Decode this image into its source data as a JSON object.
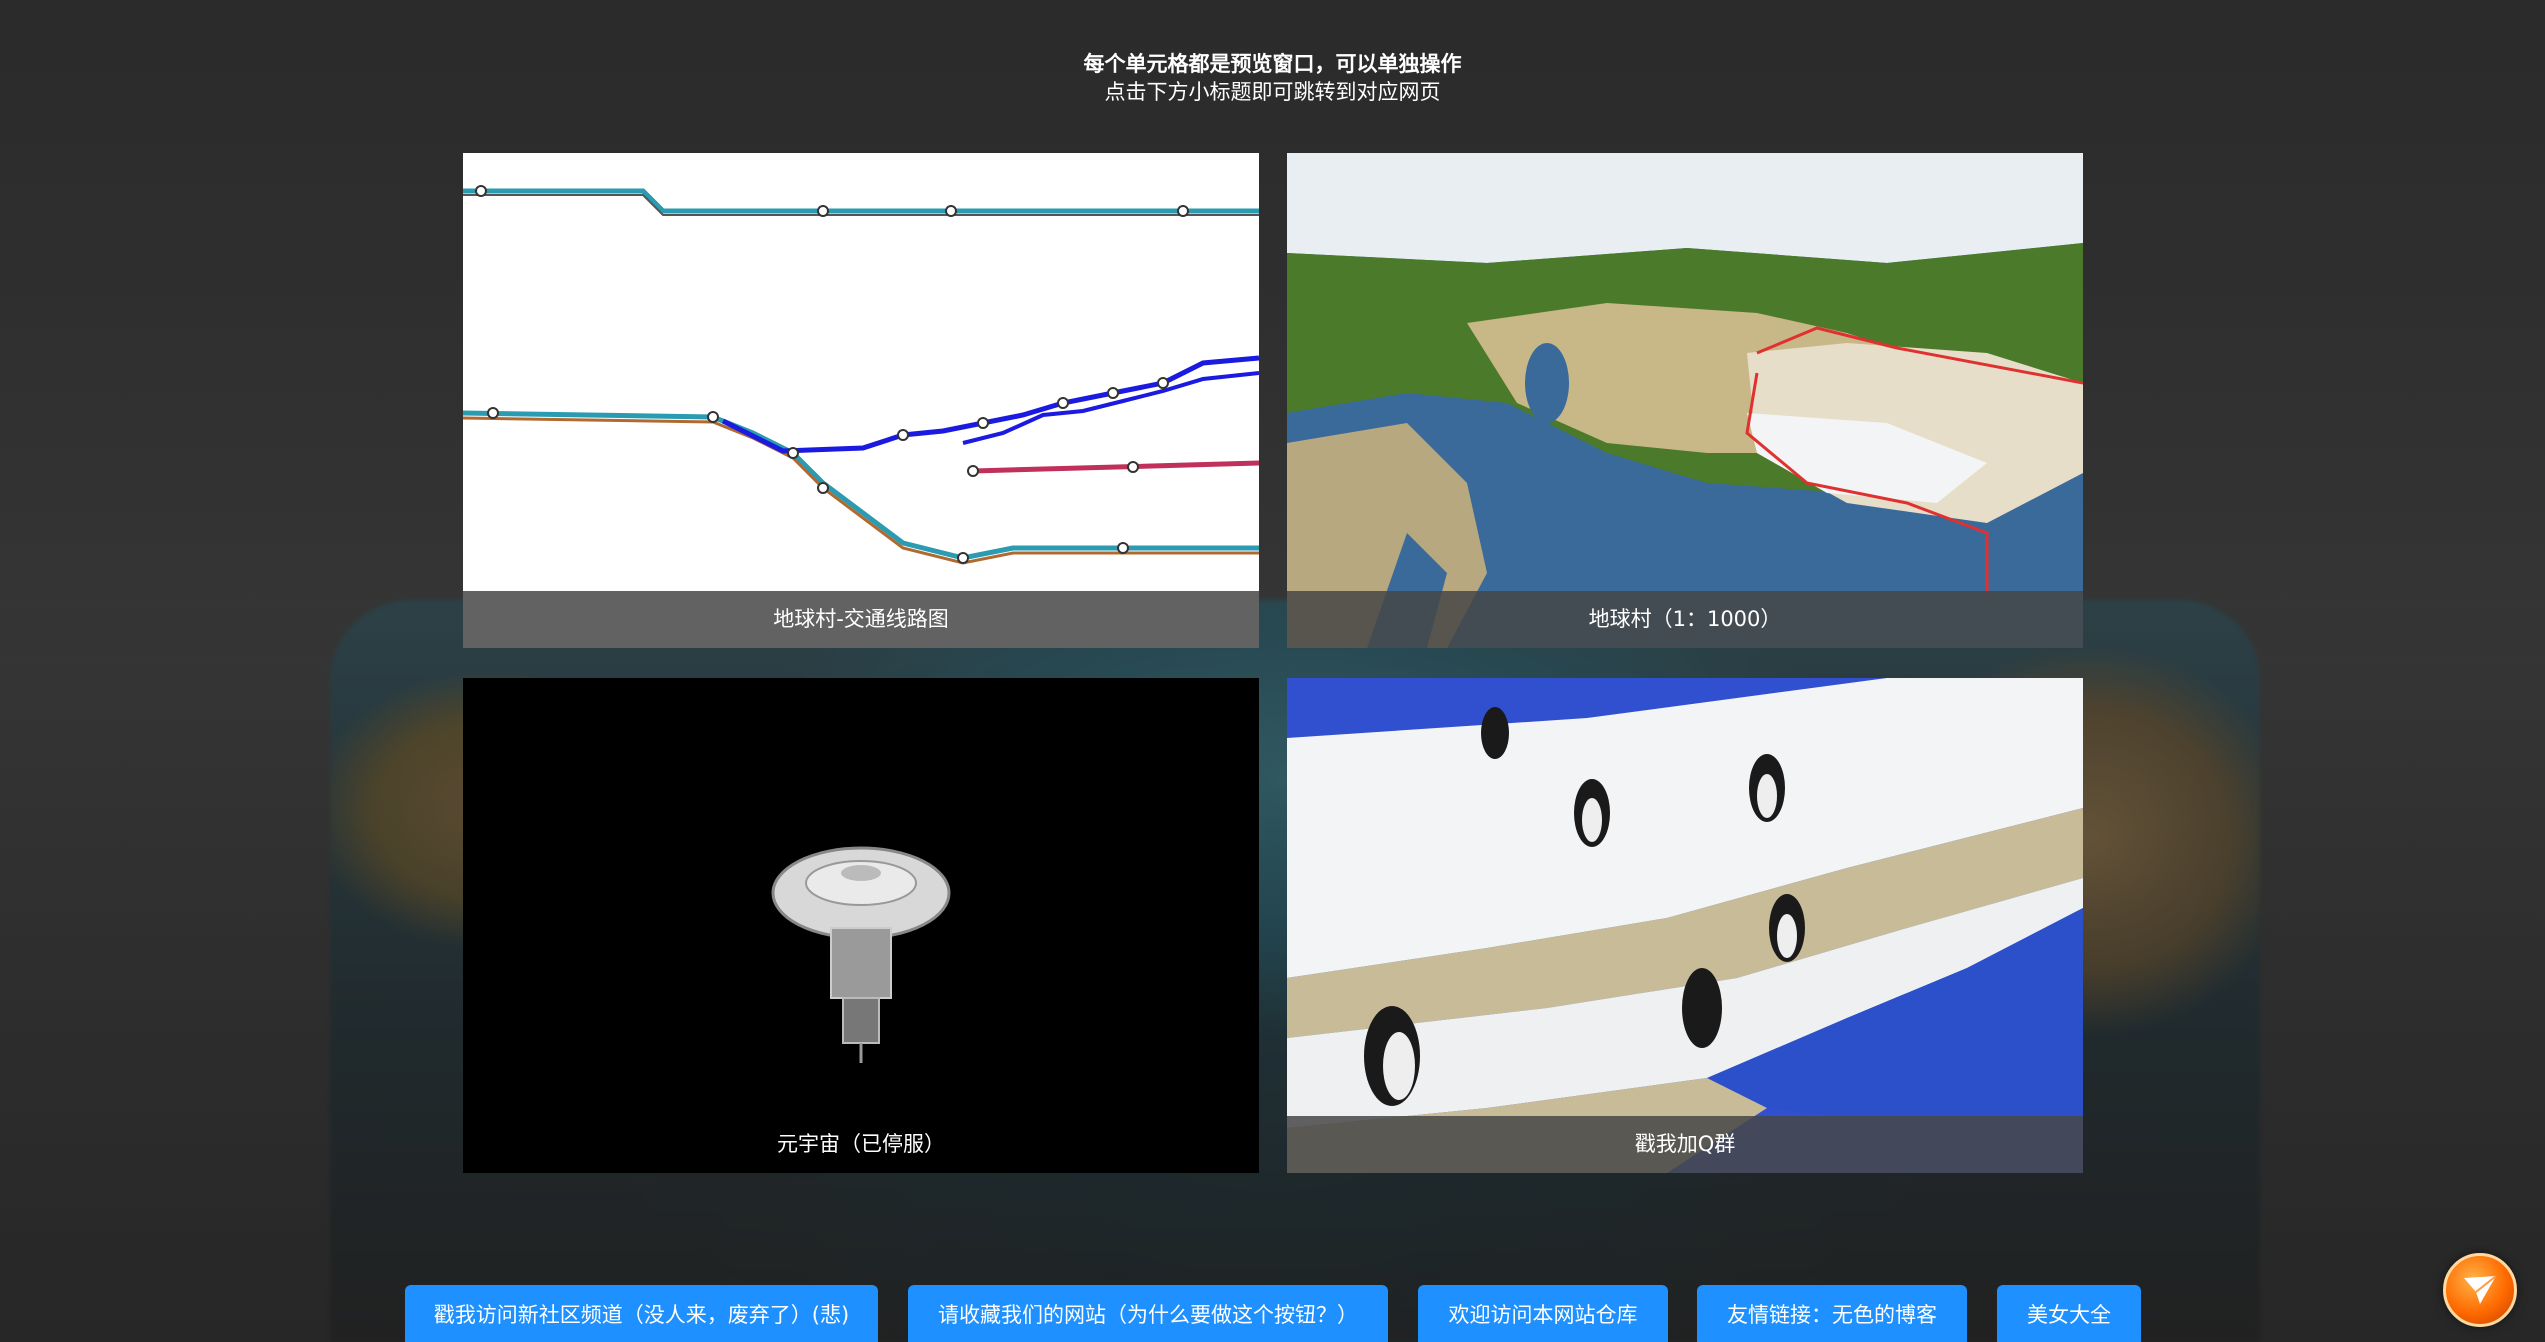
{
  "header": {
    "title": "每个单元格都是预览窗口，可以单独操作",
    "subtitle": "点击下方小标题即可跳转到对应网页"
  },
  "cells": [
    {
      "caption": "地球村-交通线路图"
    },
    {
      "caption": "地球村（1：1000）"
    },
    {
      "caption": "元宇宙（已停服）"
    },
    {
      "caption": "戳我加Q群"
    }
  ],
  "buttons": [
    "戳我访问新社区频道（没人来，废弃了）(悲)",
    "请收藏我们的网站（为什么要做这个按钮？）",
    "欢迎访问本网站仓库",
    "友情链接：无色的博客",
    "美女大全"
  ],
  "colors": {
    "button_bg": "#1e90ff",
    "caption_bg": "#464646",
    "accent_orange": "#ff6a00"
  },
  "icons": {
    "floating": "paper-plane-icon"
  }
}
